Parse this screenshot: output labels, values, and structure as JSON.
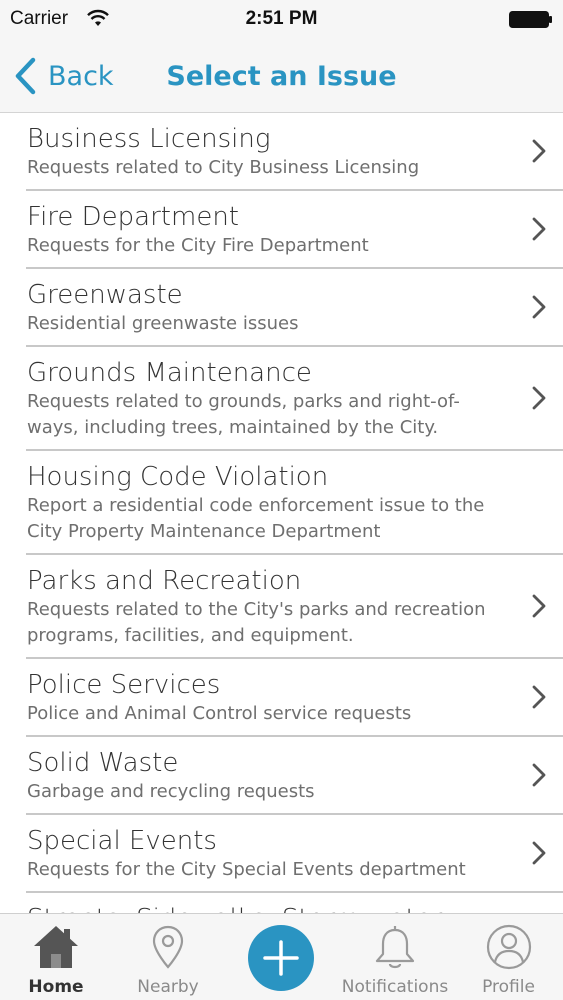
{
  "status_bar": {
    "carrier": "Carrier",
    "time": "2:51 PM"
  },
  "nav": {
    "back_label": "Back",
    "title": "Select an Issue"
  },
  "issues": [
    {
      "title": "Business Licensing",
      "subtitle": "Requests related to City Business Licensing"
    },
    {
      "title": "Fire Department",
      "subtitle": "Requests for the City Fire Department"
    },
    {
      "title": "Greenwaste",
      "subtitle": "Residential greenwaste issues"
    },
    {
      "title": "Grounds Maintenance",
      "subtitle": "Requests related to grounds, parks and right-of-ways, including trees, maintained by the City."
    },
    {
      "title": "Housing Code Violation",
      "subtitle": "Report a residential code enforcement issue to the City Property Maintenance Department"
    },
    {
      "title": "Parks and Recreation",
      "subtitle": "Requests related to the City's parks and recreation programs, facilities, and equipment."
    },
    {
      "title": "Police Services",
      "subtitle": "Police and Animal Control service requests"
    },
    {
      "title": "Solid Waste",
      "subtitle": "Garbage and recycling requests"
    },
    {
      "title": "Special Events",
      "subtitle": "Requests for the City Special Events department"
    },
    {
      "title": "Streets, Sidewalks, Storm water and",
      "subtitle": ""
    }
  ],
  "tabs": {
    "home": "Home",
    "nearby": "Nearby",
    "notifications": "Notifications",
    "profile": "Profile"
  },
  "colors": {
    "accent": "#2a94c2",
    "bar_background": "#f6f6f6",
    "divider": "#c8c8c8"
  }
}
